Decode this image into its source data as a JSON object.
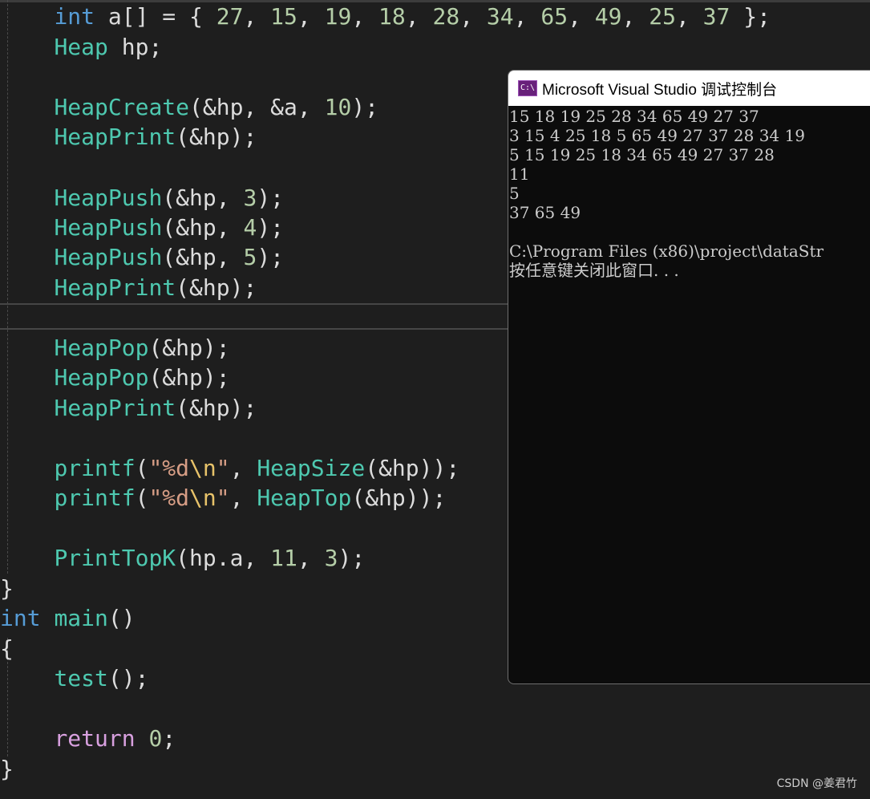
{
  "editor": {
    "lines": [
      {
        "tokens": [
          {
            "t": "    "
          },
          {
            "t": "int",
            "c": "kw"
          },
          {
            "t": " a[] = { "
          },
          {
            "t": "27",
            "c": "num"
          },
          {
            "t": ", "
          },
          {
            "t": "15",
            "c": "num"
          },
          {
            "t": ", "
          },
          {
            "t": "19",
            "c": "num"
          },
          {
            "t": ", "
          },
          {
            "t": "18",
            "c": "num"
          },
          {
            "t": ", "
          },
          {
            "t": "28",
            "c": "num"
          },
          {
            "t": ", "
          },
          {
            "t": "34",
            "c": "num"
          },
          {
            "t": ", "
          },
          {
            "t": "65",
            "c": "num"
          },
          {
            "t": ", "
          },
          {
            "t": "49",
            "c": "num"
          },
          {
            "t": ", "
          },
          {
            "t": "25",
            "c": "num"
          },
          {
            "t": ", "
          },
          {
            "t": "37",
            "c": "num"
          },
          {
            "t": " };"
          }
        ]
      },
      {
        "tokens": [
          {
            "t": "    "
          },
          {
            "t": "Heap",
            "c": "fn"
          },
          {
            "t": " hp;"
          }
        ]
      },
      {
        "tokens": []
      },
      {
        "tokens": [
          {
            "t": "    "
          },
          {
            "t": "HeapCreate",
            "c": "fn"
          },
          {
            "t": "(&hp, &a, "
          },
          {
            "t": "10",
            "c": "num"
          },
          {
            "t": ");"
          }
        ]
      },
      {
        "tokens": [
          {
            "t": "    "
          },
          {
            "t": "HeapPrint",
            "c": "fn"
          },
          {
            "t": "(&hp);"
          }
        ]
      },
      {
        "tokens": []
      },
      {
        "tokens": [
          {
            "t": "    "
          },
          {
            "t": "HeapPush",
            "c": "fn"
          },
          {
            "t": "(&hp, "
          },
          {
            "t": "3",
            "c": "num"
          },
          {
            "t": ");"
          }
        ]
      },
      {
        "tokens": [
          {
            "t": "    "
          },
          {
            "t": "HeapPush",
            "c": "fn"
          },
          {
            "t": "(&hp, "
          },
          {
            "t": "4",
            "c": "num"
          },
          {
            "t": ");"
          }
        ]
      },
      {
        "tokens": [
          {
            "t": "    "
          },
          {
            "t": "HeapPush",
            "c": "fn"
          },
          {
            "t": "(&hp, "
          },
          {
            "t": "5",
            "c": "num"
          },
          {
            "t": ");"
          }
        ]
      },
      {
        "tokens": [
          {
            "t": "    "
          },
          {
            "t": "HeapPrint",
            "c": "fn"
          },
          {
            "t": "(&hp);"
          }
        ]
      },
      {
        "tokens": []
      },
      {
        "tokens": [
          {
            "t": "    "
          },
          {
            "t": "HeapPop",
            "c": "fn"
          },
          {
            "t": "(&hp);"
          }
        ]
      },
      {
        "tokens": [
          {
            "t": "    "
          },
          {
            "t": "HeapPop",
            "c": "fn"
          },
          {
            "t": "(&hp);"
          }
        ]
      },
      {
        "tokens": [
          {
            "t": "    "
          },
          {
            "t": "HeapPrint",
            "c": "fn"
          },
          {
            "t": "(&hp);"
          }
        ]
      },
      {
        "tokens": []
      },
      {
        "tokens": [
          {
            "t": "    "
          },
          {
            "t": "printf",
            "c": "fn"
          },
          {
            "t": "("
          },
          {
            "t": "\"%d",
            "c": "str"
          },
          {
            "t": "\\n",
            "c": "esc"
          },
          {
            "t": "\"",
            "c": "str"
          },
          {
            "t": ", "
          },
          {
            "t": "HeapSize",
            "c": "fn"
          },
          {
            "t": "(&hp));"
          }
        ]
      },
      {
        "tokens": [
          {
            "t": "    "
          },
          {
            "t": "printf",
            "c": "fn"
          },
          {
            "t": "("
          },
          {
            "t": "\"%d",
            "c": "str"
          },
          {
            "t": "\\n",
            "c": "esc"
          },
          {
            "t": "\"",
            "c": "str"
          },
          {
            "t": ", "
          },
          {
            "t": "HeapTop",
            "c": "fn"
          },
          {
            "t": "(&hp));"
          }
        ]
      },
      {
        "tokens": []
      },
      {
        "tokens": [
          {
            "t": "    "
          },
          {
            "t": "PrintTopK",
            "c": "fn"
          },
          {
            "t": "(hp.a, "
          },
          {
            "t": "11",
            "c": "num"
          },
          {
            "t": ", "
          },
          {
            "t": "3",
            "c": "num"
          },
          {
            "t": ");"
          }
        ]
      },
      {
        "tokens": [
          {
            "t": "}"
          }
        ]
      },
      {
        "tokens": [
          {
            "t": "int",
            "c": "kw"
          },
          {
            "t": " "
          },
          {
            "t": "main",
            "c": "fn"
          },
          {
            "t": "()"
          }
        ]
      },
      {
        "tokens": [
          {
            "t": "{"
          }
        ]
      },
      {
        "tokens": [
          {
            "t": "    "
          },
          {
            "t": "test",
            "c": "fn"
          },
          {
            "t": "();"
          }
        ]
      },
      {
        "tokens": []
      },
      {
        "tokens": [
          {
            "t": "    "
          },
          {
            "t": "return",
            "c": "ctrl"
          },
          {
            "t": " "
          },
          {
            "t": "0",
            "c": "num"
          },
          {
            "t": ";"
          }
        ]
      },
      {
        "tokens": [
          {
            "t": "}"
          }
        ]
      }
    ]
  },
  "console": {
    "icon_label": "C:\\",
    "title": "Microsoft Visual Studio 调试控制台",
    "lines": [
      "15 18 19 25 28 34 65 49 27 37",
      "3 15 4 25 18 5 65 49 27 37 28 34 19",
      "5 15 19 25 18 34 65 49 27 37 28",
      "11",
      "5",
      "37 65 49",
      "",
      "C:\\Program Files (x86)\\project\\dataStr",
      "按任意键关闭此窗口. . ."
    ]
  },
  "watermark": "CSDN @姜君竹"
}
